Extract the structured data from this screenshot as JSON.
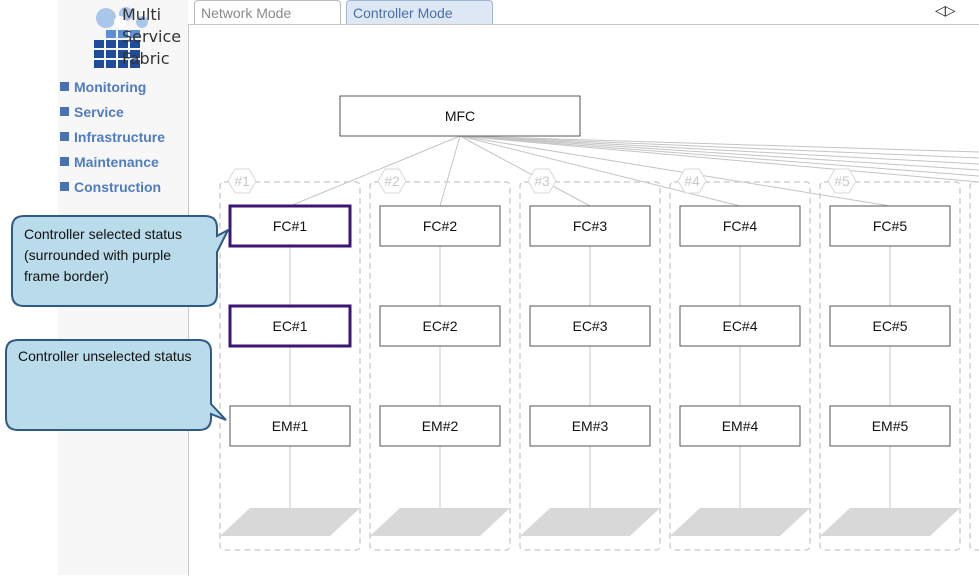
{
  "logo": {
    "lines": [
      "Multi",
      "Service",
      "Fabric"
    ]
  },
  "sidebar": {
    "items": [
      {
        "label": "Monitoring"
      },
      {
        "label": "Service"
      },
      {
        "label": "Infrastructure"
      },
      {
        "label": "Maintenance"
      },
      {
        "label": "Construction"
      }
    ]
  },
  "tabs": [
    {
      "label": "Network Mode",
      "active": false
    },
    {
      "label": "Controller Mode",
      "active": true
    }
  ],
  "nav_arrows": "◁▷",
  "diagram": {
    "root": {
      "label": "MFC"
    },
    "groups": [
      {
        "tag": "#1",
        "fc": "FC#1",
        "ec": "EC#1",
        "em": "EM#1",
        "selected": true
      },
      {
        "tag": "#2",
        "fc": "FC#2",
        "ec": "EC#2",
        "em": "EM#2",
        "selected": false
      },
      {
        "tag": "#3",
        "fc": "FC#3",
        "ec": "EC#3",
        "em": "EM#3",
        "selected": false
      },
      {
        "tag": "#4",
        "fc": "FC#4",
        "ec": "EC#4",
        "em": "EM#4",
        "selected": false
      },
      {
        "tag": "#5",
        "fc": "FC#5",
        "ec": "EC#5",
        "em": "EM#5",
        "selected": false
      }
    ]
  },
  "callouts": {
    "selected": "Controller selected status (surrounded with purple frame border)",
    "unselected": "Controller unselected status"
  },
  "colors": {
    "selected_border": "#3b1673",
    "callout_fill": "#b9dbea",
    "callout_border": "#2f5a86",
    "link_blue": "#4f7cc0"
  }
}
